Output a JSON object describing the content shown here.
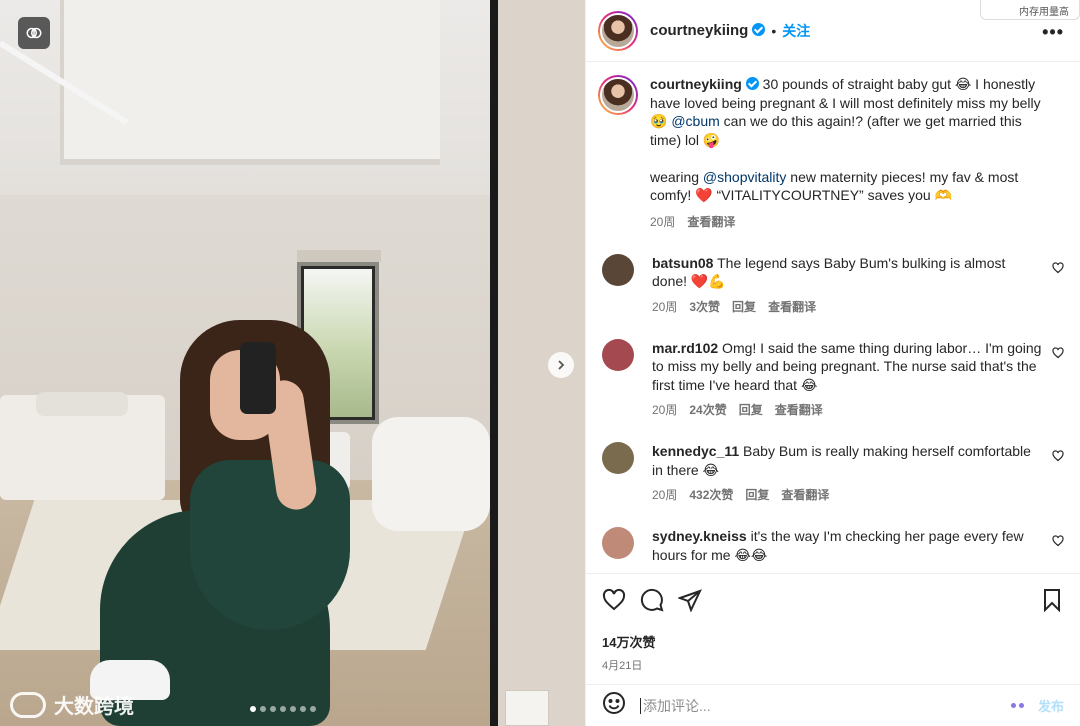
{
  "media": {
    "watermark_text": "大数跨境",
    "dots_count": 7,
    "active_dot": 0
  },
  "header": {
    "username": "courtneykiing",
    "separator": "•",
    "follow_label": "关注",
    "more_label": "•••",
    "top_chip_text": "内存用量高"
  },
  "caption": {
    "username": "courtneykiing",
    "part1": " 30 pounds of straight baby gut 😂 I honestly have loved being pregnant & I will most definitely miss my belly 🥹 ",
    "mention1": "@cbum",
    "part2": " can we do this again!? (after we get married this time) lol 🤪",
    "part3": "wearing ",
    "mention2": "@shopvitality",
    "part4": " new maternity pieces! my fav & most comfy! ❤️ “VITALITYCOURTNEY” saves you 🫶",
    "time": "20周",
    "translate": "查看翻译"
  },
  "comments": [
    {
      "username": "batsun08",
      "text": " The legend says Baby Bum's bulking is almost done! ❤️💪",
      "time": "20周",
      "likes": "3次赞",
      "reply": "回复",
      "translate": "查看翻译",
      "avatar_color": "#5a4636"
    },
    {
      "username": "mar.rd102",
      "text": " Omg! I said the same thing during labor… I'm going to miss my belly and being pregnant. The nurse said that's the first time I've heard that 😂",
      "time": "20周",
      "likes": "24次赞",
      "reply": "回复",
      "translate": "查看翻译",
      "avatar_color": "#a4494f"
    },
    {
      "username": "kennedyc_11",
      "text": " Baby Bum is really making herself comfortable in there 😂",
      "time": "20周",
      "likes": "432次赞",
      "reply": "回复",
      "translate": "查看翻译",
      "avatar_color": "#7a6a4e"
    },
    {
      "username": "sydney.kneiss",
      "text": " it's the way I'm checking her page every few hours for me 😂😂",
      "time": "",
      "likes": "",
      "reply": "",
      "translate": "",
      "avatar_color": "#c08a78"
    }
  ],
  "actions": {
    "likes": "14万次赞",
    "date": "4月21日"
  },
  "comment_box": {
    "placeholder": "添加评论...",
    "post_label": "发布"
  }
}
